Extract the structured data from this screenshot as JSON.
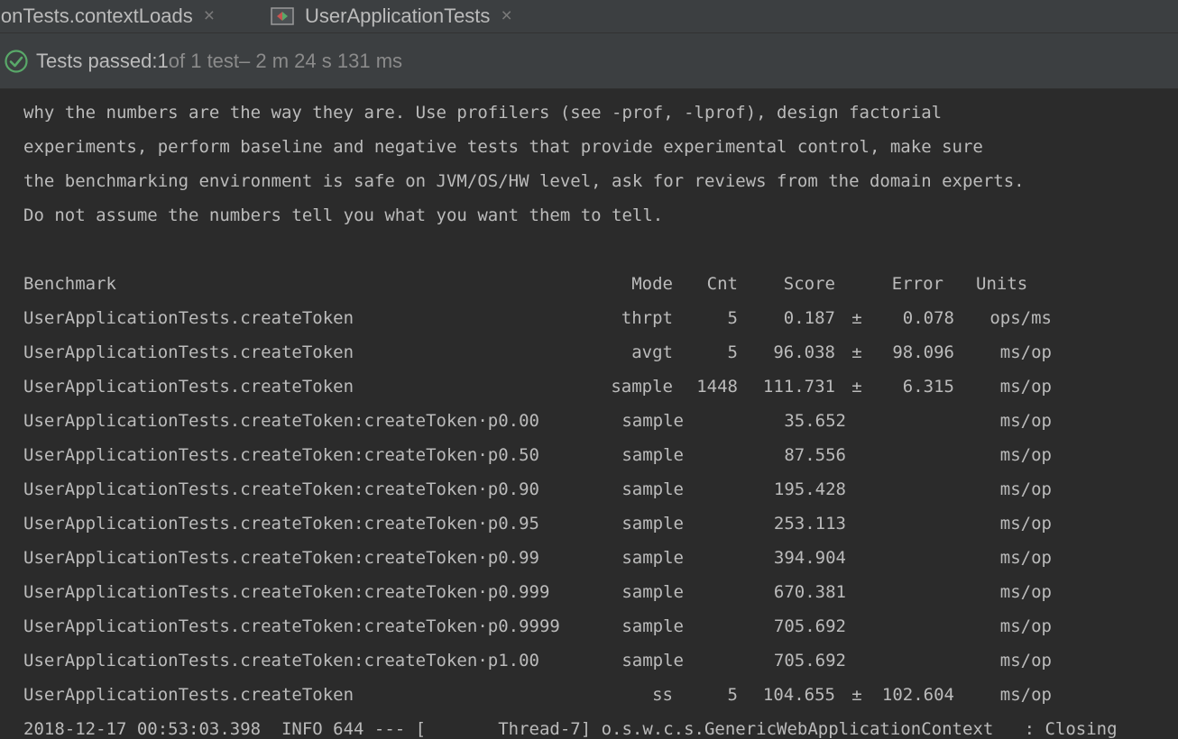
{
  "tabs": [
    {
      "label": "ionTests.contextLoads",
      "close": "×"
    },
    {
      "label": "UserApplicationTests",
      "close": "×",
      "icon": "run-config-icon"
    }
  ],
  "status": {
    "icon": "check-circle-icon",
    "passed_label": "Tests passed: ",
    "passed_count": "1",
    "passed_rest": " of 1 test",
    "duration": " – 2 m 24 s 131 ms"
  },
  "console": {
    "intro": [
      "why the numbers are the way they are. Use profilers (see -prof, -lprof), design factorial",
      "experiments, perform baseline and negative tests that provide experimental control, make sure",
      "the benchmarking environment is safe on JVM/OS/HW level, ask for reviews from the domain experts.",
      "Do not assume the numbers tell you what you want them to tell."
    ],
    "headers": {
      "benchmark": "Benchmark",
      "mode": "Mode",
      "cnt": "Cnt",
      "score": "Score",
      "error": "Error",
      "units": "Units"
    },
    "rows": [
      {
        "name": "UserApplicationTests.createToken",
        "mode": "thrpt",
        "cnt": "5",
        "score": "0.187",
        "pm": "±",
        "error": "0.078",
        "units": "ops/ms"
      },
      {
        "name": "UserApplicationTests.createToken",
        "mode": "avgt",
        "cnt": "5",
        "score": "96.038",
        "pm": "±",
        "error": "98.096",
        "units": "ms/op"
      },
      {
        "name": "UserApplicationTests.createToken",
        "mode": "sample",
        "cnt": "1448",
        "score": "111.731",
        "pm": "±",
        "error": "6.315",
        "units": "ms/op"
      },
      {
        "name": "UserApplicationTests.createToken:createToken·p0.00",
        "mode": "sample",
        "cnt": "",
        "score": "35.652",
        "pm": "",
        "error": "",
        "units": "ms/op"
      },
      {
        "name": "UserApplicationTests.createToken:createToken·p0.50",
        "mode": "sample",
        "cnt": "",
        "score": "87.556",
        "pm": "",
        "error": "",
        "units": "ms/op"
      },
      {
        "name": "UserApplicationTests.createToken:createToken·p0.90",
        "mode": "sample",
        "cnt": "",
        "score": "195.428",
        "pm": "",
        "error": "",
        "units": "ms/op"
      },
      {
        "name": "UserApplicationTests.createToken:createToken·p0.95",
        "mode": "sample",
        "cnt": "",
        "score": "253.113",
        "pm": "",
        "error": "",
        "units": "ms/op"
      },
      {
        "name": "UserApplicationTests.createToken:createToken·p0.99",
        "mode": "sample",
        "cnt": "",
        "score": "394.904",
        "pm": "",
        "error": "",
        "units": "ms/op"
      },
      {
        "name": "UserApplicationTests.createToken:createToken·p0.999",
        "mode": "sample",
        "cnt": "",
        "score": "670.381",
        "pm": "",
        "error": "",
        "units": "ms/op"
      },
      {
        "name": "UserApplicationTests.createToken:createToken·p0.9999",
        "mode": "sample",
        "cnt": "",
        "score": "705.692",
        "pm": "",
        "error": "",
        "units": "ms/op"
      },
      {
        "name": "UserApplicationTests.createToken:createToken·p1.00",
        "mode": "sample",
        "cnt": "",
        "score": "705.692",
        "pm": "",
        "error": "",
        "units": "ms/op"
      },
      {
        "name": "UserApplicationTests.createToken",
        "mode": "ss",
        "cnt": "5",
        "score": "104.655",
        "pm": "±",
        "error": "102.604",
        "units": "ms/op"
      }
    ],
    "log_line": "2018-12-17 00:53:03.398  INFO 644 --- [       Thread-7] o.s.w.c.s.GenericWebApplicationContext   : Closing"
  },
  "colors": {
    "background": "#2b2b2b",
    "panel": "#3c3f41",
    "text": "#bbbbbb",
    "muted": "#8b8b8b",
    "success": "#59a869"
  }
}
